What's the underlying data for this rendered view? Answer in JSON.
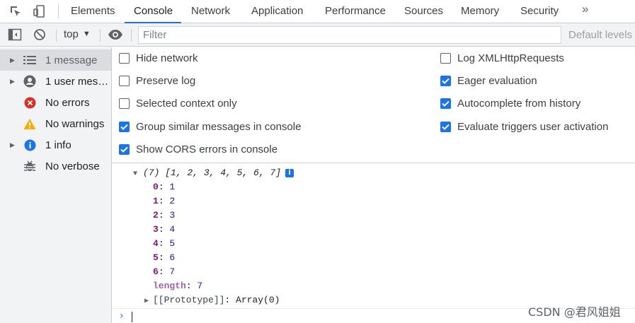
{
  "tabbar": {
    "inspect_icon": "element-picker-icon",
    "device_icon": "device-toolbar-icon",
    "tabs": [
      {
        "label": "Elements"
      },
      {
        "label": "Console"
      },
      {
        "label": "Network"
      },
      {
        "label": "Application"
      },
      {
        "label": "Performance"
      },
      {
        "label": "Sources"
      },
      {
        "label": "Memory"
      },
      {
        "label": "Security"
      }
    ],
    "more": "»",
    "active_tab": "Console"
  },
  "toolbar": {
    "context": "top",
    "filter_placeholder": "Filter",
    "filter_value": "",
    "levels_label": "Default levels"
  },
  "sidebar": {
    "items": [
      {
        "label": "1 message",
        "icon": "list-icon",
        "expandable": true
      },
      {
        "label": "1 user mess…",
        "icon": "user-icon",
        "expandable": true
      },
      {
        "label": "No errors",
        "icon": "error-icon",
        "expandable": false
      },
      {
        "label": "No warnings",
        "icon": "warning-icon",
        "expandable": false
      },
      {
        "label": "1 info",
        "icon": "info-icon",
        "expandable": true
      },
      {
        "label": "No verbose",
        "icon": "bug-icon",
        "expandable": false
      }
    ]
  },
  "settings": {
    "left": [
      {
        "label": "Hide network",
        "checked": false
      },
      {
        "label": "Preserve log",
        "checked": false
      },
      {
        "label": "Selected context only",
        "checked": false
      },
      {
        "label": "Group similar messages in console",
        "checked": true
      },
      {
        "label": "Show CORS errors in console",
        "checked": true
      }
    ],
    "right": [
      {
        "label": "Log XMLHttpRequests",
        "checked": false
      },
      {
        "label": "Eager evaluation",
        "checked": true
      },
      {
        "label": "Autocomplete from history",
        "checked": true
      },
      {
        "label": "Evaluate triggers user activation",
        "checked": true
      }
    ]
  },
  "console": {
    "array_summary": "(7) [1, 2, 3, 4, 5, 6, 7]",
    "entries": [
      {
        "key": "0",
        "value": "1"
      },
      {
        "key": "1",
        "value": "2"
      },
      {
        "key": "2",
        "value": "3"
      },
      {
        "key": "3",
        "value": "4"
      },
      {
        "key": "4",
        "value": "5"
      },
      {
        "key": "5",
        "value": "6"
      },
      {
        "key": "6",
        "value": "7"
      }
    ],
    "length_key": "length",
    "length_value": "7",
    "prototype_key": "[[Prototype]]",
    "prototype_value": "Array(0)",
    "info_badge": "i"
  },
  "colors": {
    "accent": "#1a73e8",
    "error": "#d93025",
    "warning": "#f9ab00",
    "key": "#881280",
    "number": "#1a1aa6"
  },
  "watermark": "CSDN @君风姐姐"
}
